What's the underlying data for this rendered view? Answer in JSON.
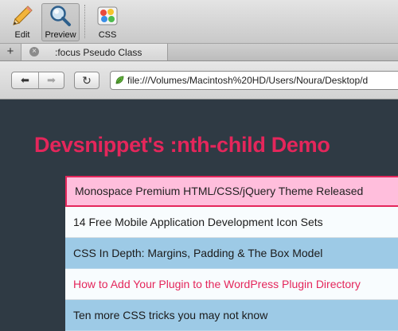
{
  "toolbar": {
    "edit_label": "Edit",
    "preview_label": "Preview",
    "css_label": "CSS",
    "edit_icon": "pencil-icon",
    "preview_icon": "magnifier-icon",
    "css_icon": "color-palette-icon"
  },
  "tabs": {
    "new_tab_symbol": "+",
    "close_symbol": "×",
    "active_title": ":focus Pseudo Class"
  },
  "nav": {
    "back_symbol": "⬅",
    "forward_symbol": "➡",
    "reload_symbol": "↻",
    "url": "file:///Volumes/Macintosh%20HD/Users/Noura/Desktop/d"
  },
  "page": {
    "title": "Devsnippet's :nth-child Demo",
    "items": [
      "Monospace Premium HTML/CSS/jQuery Theme Released",
      "14 Free Mobile Application Development Icon Sets",
      "CSS In Depth: Margins, Padding & The Box Model",
      "How to Add Your Plugin to the WordPress Plugin Directory",
      "Ten more CSS tricks you may not know"
    ]
  },
  "colors": {
    "accent": "#e4265b",
    "page_background": "#2f3a44",
    "highlight_row": "#ffbedc",
    "blue_row": "#9dcae6",
    "white_row": "#f8fcfe"
  }
}
